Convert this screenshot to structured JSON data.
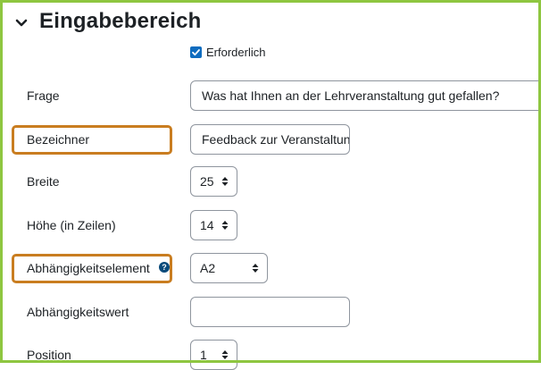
{
  "section": {
    "title": "Eingabebereich",
    "toggle_icon": "chevron-down-icon"
  },
  "required": {
    "label": "Erforderlich",
    "checked": true
  },
  "fields": {
    "frage": {
      "label": "Frage",
      "value": "Was hat Ihnen an der Lehrveranstaltung gut gefallen?"
    },
    "bezeichner": {
      "label": "Bezeichner",
      "value": "Feedback zur Veranstaltung"
    },
    "breite": {
      "label": "Breite",
      "value": "25"
    },
    "hoehe": {
      "label": "Höhe (in Zeilen)",
      "value": "14"
    },
    "abhaengigkeitselement": {
      "label": "Abhängigkeitselement",
      "value": "A2",
      "help_icon": "question-circle-icon"
    },
    "abhaengigkeitswert": {
      "label": "Abhängigkeitswert",
      "value": ""
    },
    "position": {
      "label": "Position",
      "value": "1"
    }
  },
  "colors": {
    "accent": "#0f6cbf",
    "highlight": "#c97d20",
    "frame": "#8ec640",
    "help": "#0a4a7a"
  }
}
